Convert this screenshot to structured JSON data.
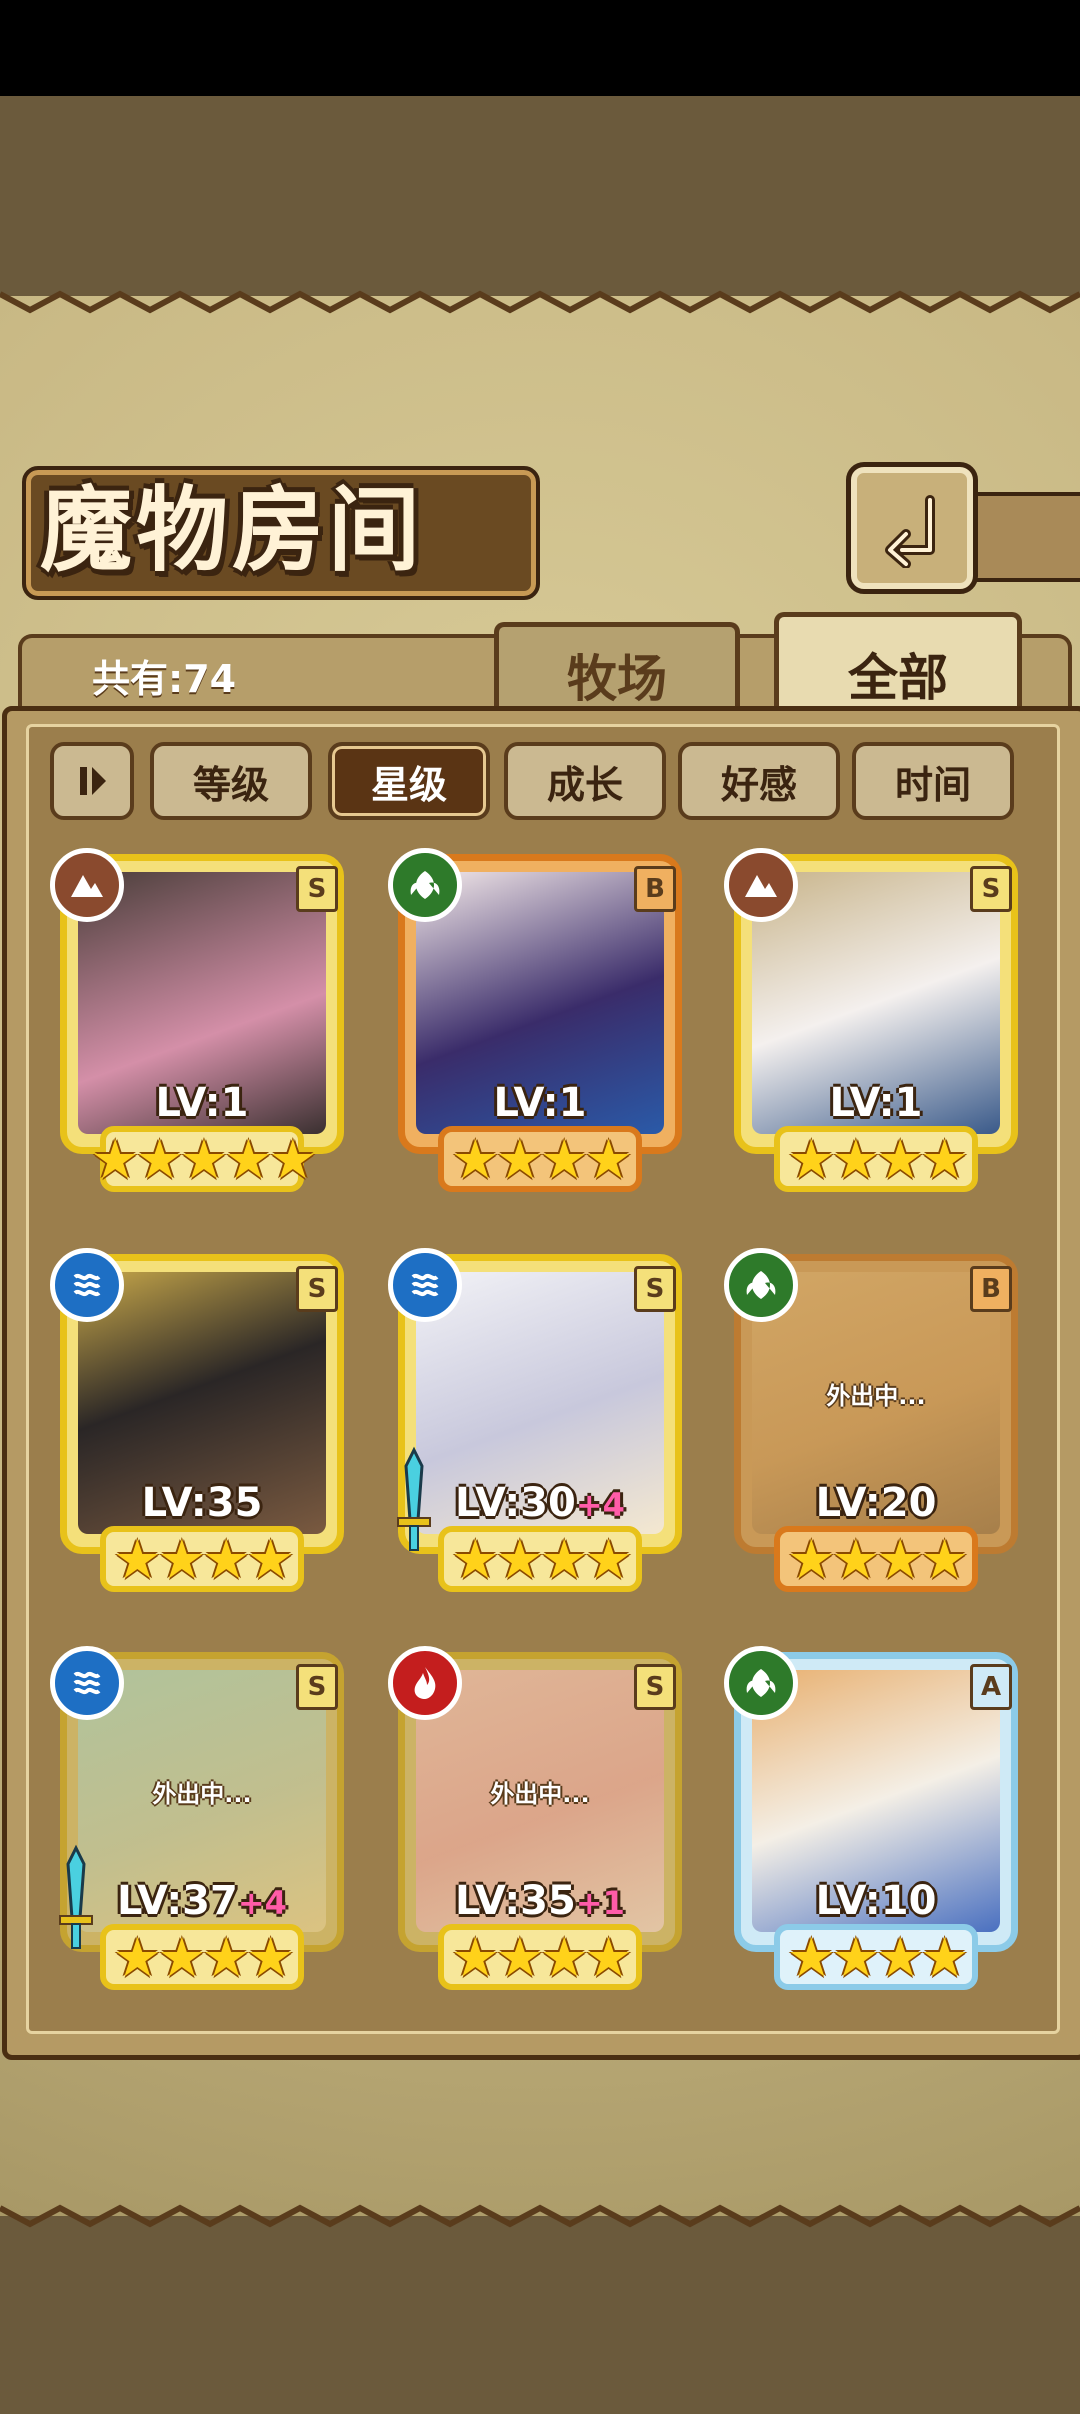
{
  "screen": {
    "title": "魔物房间"
  },
  "header": {
    "count_text": "共有:74"
  },
  "tabs": [
    {
      "label": "牧场"
    },
    {
      "label": "全部"
    }
  ],
  "sort_buttons": [
    {
      "label": "等级"
    },
    {
      "label": "星级"
    },
    {
      "label": "成长"
    },
    {
      "label": "好感"
    },
    {
      "label": "时间"
    }
  ],
  "active_sort": "星级",
  "monsters": [
    {
      "level": "LV:1",
      "bonus": "",
      "rank": "S",
      "element": "earth",
      "stars": 5,
      "star_text": "★★★★★",
      "status": ""
    },
    {
      "level": "LV:1",
      "bonus": "",
      "rank": "B",
      "element": "nature",
      "stars": 4,
      "star_text": "★★★★",
      "status": ""
    },
    {
      "level": "LV:1",
      "bonus": "",
      "rank": "S",
      "element": "earth",
      "stars": 4,
      "star_text": "★★★★",
      "status": ""
    },
    {
      "level": "LV:35",
      "bonus": "",
      "rank": "S",
      "element": "water",
      "stars": 4,
      "star_text": "★★★★",
      "status": ""
    },
    {
      "level": "LV:30",
      "bonus": "+4",
      "rank": "S",
      "element": "water",
      "stars": 4,
      "star_text": "★★★★",
      "status": ""
    },
    {
      "level": "LV:20",
      "bonus": "",
      "rank": "B",
      "element": "nature",
      "stars": 4,
      "star_text": "★★★★",
      "status": "外出中..."
    },
    {
      "level": "LV:37",
      "bonus": "+4",
      "rank": "S",
      "element": "water",
      "stars": 4,
      "star_text": "★★★★",
      "status": "外出中..."
    },
    {
      "level": "LV:35",
      "bonus": "+1",
      "rank": "S",
      "element": "fire",
      "stars": 4,
      "star_text": "★★★★",
      "status": "外出中..."
    },
    {
      "level": "LV:10",
      "bonus": "",
      "rank": "A",
      "element": "nature",
      "stars": 4,
      "star_text": "★★★★",
      "status": ""
    }
  ],
  "colors": {
    "gold_frame": "#e8c21a",
    "bronze_frame": "#d9791c",
    "blue_frame": "#8ccbe8",
    "earth": "#8a4a2e",
    "nature": "#2e7a2a",
    "water": "#1e6fc4",
    "fire": "#c41e1e"
  }
}
